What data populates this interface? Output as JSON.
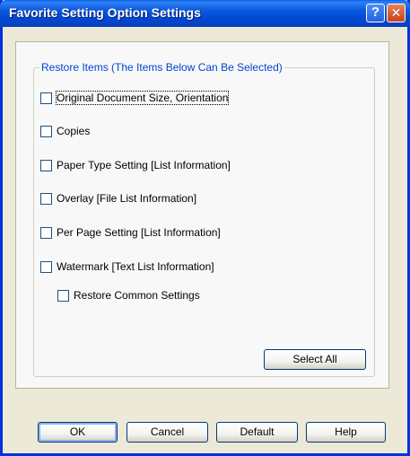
{
  "window": {
    "title": "Favorite Setting Option Settings"
  },
  "titlebar": {
    "help_glyph": "?",
    "close_glyph": "✕"
  },
  "group": {
    "legend": "Restore Items (The Items Below Can Be Selected)",
    "items": [
      {
        "label": "Original Document Size, Orientation",
        "checked": false
      },
      {
        "label": "Copies",
        "checked": false
      },
      {
        "label": "Paper Type Setting [List Information]",
        "checked": false
      },
      {
        "label": "Overlay [File List Information]",
        "checked": false
      },
      {
        "label": "Per Page Setting [List Information]",
        "checked": false
      },
      {
        "label": "Watermark [Text List Information]",
        "checked": false
      },
      {
        "label": "Restore Common Settings",
        "checked": false
      }
    ],
    "select_all_label": "Select All"
  },
  "buttons": {
    "ok": "OK",
    "cancel": "Cancel",
    "default": "Default",
    "help": "Help"
  }
}
